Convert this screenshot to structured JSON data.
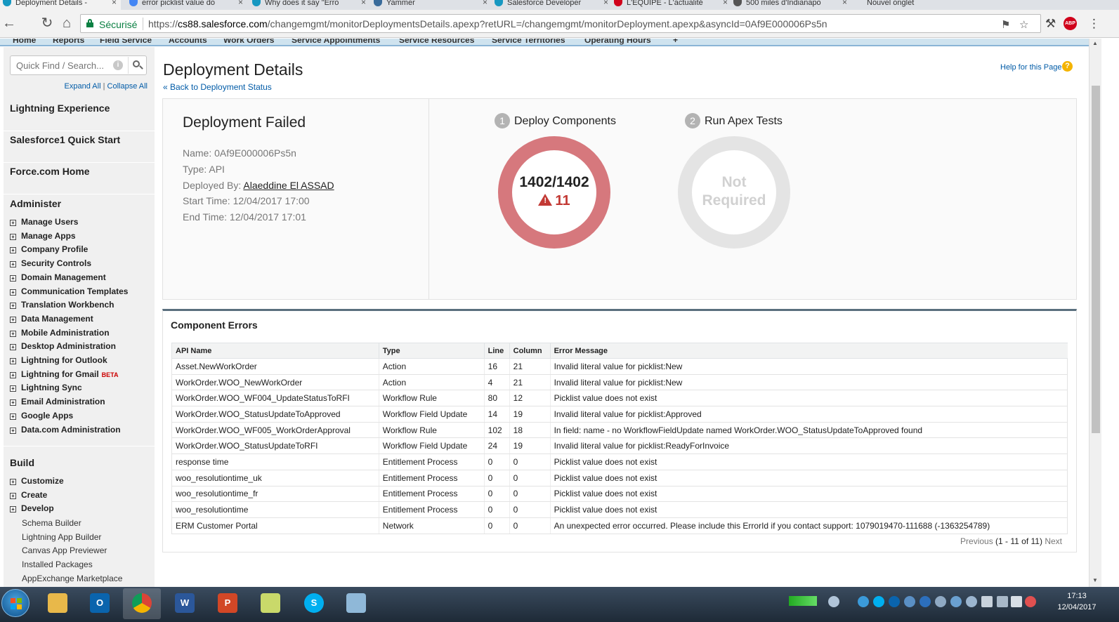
{
  "browser": {
    "tabs": [
      {
        "title": "Deployment Details -",
        "color": "#1798c1"
      },
      {
        "title": "error picklist value do",
        "color": "#4285f4"
      },
      {
        "title": "Why does it say \"Erro",
        "color": "#1798c1"
      },
      {
        "title": "Yammer",
        "color": "#396b9a"
      },
      {
        "title": "Salesforce Developer",
        "color": "#1798c1"
      },
      {
        "title": "L'ÉQUIPE - L'actualité",
        "color": "#d0021b"
      },
      {
        "title": "500 miles d'Indianapo",
        "color": "#555555"
      },
      {
        "title": "Nouvel onglet",
        "color": "#dee1e6"
      }
    ],
    "secure_label": "Sécurisé",
    "url_prefix": "https://",
    "url_host": "cs88.salesforce.com",
    "url_path": "/changemgmt/monitorDeploymentsDetails.apexp?retURL=/changemgmt/monitorDeployment.apexp&asyncId=0Af9E000006Ps5n",
    "abp_label": "ABP"
  },
  "sf_nav": [
    "Home",
    "Reports",
    "Field Service",
    "Accounts",
    "Work Orders",
    "Service Appointments",
    "Service Resources",
    "Service Territories",
    "Operating Hours",
    "+"
  ],
  "sidebar": {
    "search_placeholder": "Quick Find / Search...",
    "expand_all": "Expand All",
    "divider": "|",
    "collapse_all": "Collapse All",
    "top_links": [
      "Lightning Experience",
      "Salesforce1 Quick Start",
      "Force.com Home"
    ],
    "administer_title": "Administer",
    "administer_items": [
      "Manage Users",
      "Manage Apps",
      "Company Profile",
      "Security Controls",
      "Domain Management",
      "Communication Templates",
      "Translation Workbench",
      "Data Management",
      "Mobile Administration",
      "Desktop Administration",
      "Lightning for Outlook",
      "Lightning for Gmail",
      "Lightning Sync",
      "Email Administration",
      "Google Apps",
      "Data.com Administration"
    ],
    "beta_label": "BETA",
    "build_title": "Build",
    "build_items": [
      "Customize",
      "Create",
      "Develop"
    ],
    "build_sub_items": [
      "Schema Builder",
      "Lightning App Builder",
      "Canvas App Previewer",
      "Installed Packages",
      "AppExchange Marketplace"
    ]
  },
  "header": {
    "title": "Deployment Details",
    "back_link": "« Back to Deployment Status",
    "help_link": "Help for this Page"
  },
  "deployment": {
    "status_title": "Deployment Failed",
    "name_label": "Name:",
    "name_value": "0Af9E000006Ps5n",
    "type_label": "Type:",
    "type_value": "API",
    "deployed_by_label": "Deployed By:",
    "deployed_by_value": "Alaeddine El ASSAD",
    "start_label": "Start Time:",
    "start_value": "12/04/2017 17:00",
    "end_label": "End Time:",
    "end_value": "12/04/2017 17:01",
    "step1_num": "1",
    "step1_title": "Deploy Components",
    "step1_count": "1402/1402",
    "step1_errors": "11",
    "step2_num": "2",
    "step2_title": "Run Apex Tests",
    "step2_status_line1": "Not",
    "step2_status_line2": "Required",
    "warn_color": "#c23934",
    "fail_ring_color": "#d6787d"
  },
  "errors": {
    "title": "Component Errors",
    "columns": [
      "API Name",
      "Type",
      "Line",
      "Column",
      "Error Message"
    ],
    "rows": [
      [
        "Asset.NewWorkOrder",
        "Action",
        "16",
        "21",
        "Invalid literal value for picklist:New"
      ],
      [
        "WorkOrder.WOO_NewWorkOrder",
        "Action",
        "4",
        "21",
        "Invalid literal value for picklist:New"
      ],
      [
        "WorkOrder.WOO_WF004_UpdateStatusToRFI",
        "Workflow Rule",
        "80",
        "12",
        "Picklist value does not exist"
      ],
      [
        "WorkOrder.WOO_StatusUpdateToApproved",
        "Workflow Field Update",
        "14",
        "19",
        "Invalid literal value for picklist:Approved"
      ],
      [
        "WorkOrder.WOO_WF005_WorkOrderApproval",
        "Workflow Rule",
        "102",
        "18",
        "In field: name - no WorkflowFieldUpdate named WorkOrder.WOO_StatusUpdateToApproved found"
      ],
      [
        "WorkOrder.WOO_StatusUpdateToRFI",
        "Workflow Field Update",
        "24",
        "19",
        "Invalid literal value for picklist:ReadyForInvoice"
      ],
      [
        "response time",
        "Entitlement Process",
        "0",
        "0",
        "Picklist value does not exist"
      ],
      [
        "woo_resolutiontime_uk",
        "Entitlement Process",
        "0",
        "0",
        "Picklist value does not exist"
      ],
      [
        "woo_resolutiontime_fr",
        "Entitlement Process",
        "0",
        "0",
        "Picklist value does not exist"
      ],
      [
        "woo_resolutiontime",
        "Entitlement Process",
        "0",
        "0",
        "Picklist value does not exist"
      ],
      [
        "ERM Customer Portal",
        "Network",
        "0",
        "0",
        "An unexpected error occurred. Please include this ErrorId if you contact support: 1079019470-111688 (-1363254789)"
      ]
    ],
    "pager_prev": "Previous",
    "pager_range": "(1 - 11 of 11)",
    "pager_next": "Next"
  },
  "taskbar": {
    "apps": [
      {
        "name": "explorer",
        "color": "#e8b84a",
        "label": ""
      },
      {
        "name": "outlook",
        "color": "#0a64ad",
        "label": "O"
      },
      {
        "name": "chrome",
        "color": "#dd4b39",
        "label": ""
      },
      {
        "name": "word",
        "color": "#2b579a",
        "label": "W"
      },
      {
        "name": "powerpoint",
        "color": "#d24726",
        "label": "P"
      },
      {
        "name": "folder",
        "color": "#c9d96a",
        "label": ""
      },
      {
        "name": "skype",
        "color": "#00aff0",
        "label": "S"
      },
      {
        "name": "notes",
        "color": "#8fb8d8",
        "label": ""
      }
    ],
    "time": "17:13",
    "date": "12/04/2017"
  }
}
